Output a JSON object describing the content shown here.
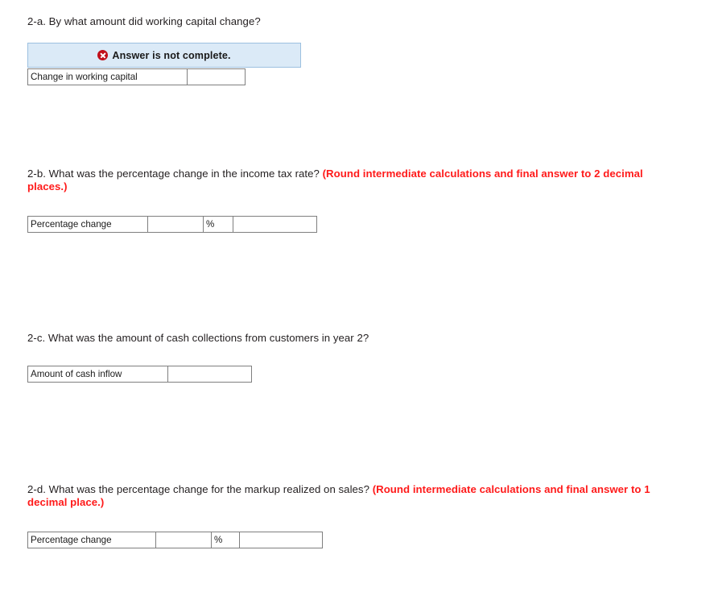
{
  "sections": [
    {
      "id": "2a",
      "question_prefix": "2-a. By what amount did working capital change?",
      "question_note": "",
      "alert": {
        "icon": "error-circle-x-icon",
        "text": "Answer is not complete."
      },
      "table": {
        "label": "Change in working capital",
        "value": "",
        "unit": "",
        "extra": ""
      }
    },
    {
      "id": "2b",
      "question_prefix": "2-b. What was the percentage change in the income tax rate? ",
      "question_note": "(Round intermediate calculations and final answer to 2 decimal places.)",
      "table": {
        "label": "Percentage change",
        "value": "",
        "unit": "%",
        "extra": ""
      }
    },
    {
      "id": "2c",
      "question_prefix": "2-c. What was the amount of cash collections from customers in year 2?",
      "question_note": "",
      "table": {
        "label": "Amount of cash inflow",
        "value": "",
        "unit": "",
        "extra": ""
      }
    },
    {
      "id": "2d",
      "question_prefix": "2-d. What was the percentage change for the markup realized on sales? ",
      "question_note": "(Round intermediate calculations and final answer to 1 decimal place.)",
      "table": {
        "label": "Percentage change",
        "value": "",
        "unit": "%",
        "extra": ""
      }
    }
  ],
  "colors": {
    "alert_background": "#dbeaf7",
    "alert_border": "#9cc0e0",
    "alert_icon": "#c10f1a",
    "label_cell": "#7ea8dd",
    "cell_border": "#7f7f7f",
    "note_text": "#ff1a1a",
    "body_text": "#231f20",
    "page_background": "#ffffff"
  }
}
